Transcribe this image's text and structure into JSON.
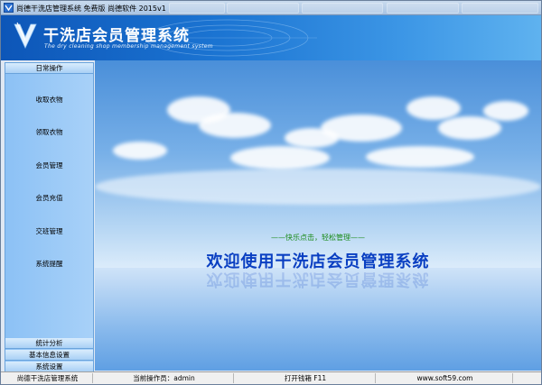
{
  "window": {
    "title": "尚德干洗店管理系统 免费版 尚德软件 2015v1"
  },
  "banner": {
    "title": "干洗店会员管理系统",
    "subtitle": "The dry cleaning shop membership management system"
  },
  "sidebar": {
    "top_header": "日常操作",
    "items": [
      {
        "label": "收取衣物",
        "icon": "none"
      },
      {
        "label": "领取衣物",
        "icon": "none"
      },
      {
        "label": "会员管理",
        "icon": "none"
      },
      {
        "label": "会员充值",
        "icon": "none"
      },
      {
        "label": "交班管理",
        "icon": "none"
      },
      {
        "label": "系统提醒",
        "icon": "none"
      }
    ],
    "bottom_headers": [
      "统计分析",
      "基本信息设置",
      "系统设置"
    ]
  },
  "main": {
    "tagline": "——快乐点击，轻松管理——",
    "welcome": "欢迎使用干洗店会员管理系统"
  },
  "statusbar": {
    "app_name": "尚德干洗店管理系统",
    "operator": "当前操作员：admin",
    "cashbox": "打开钱箱 F11",
    "website": "www.soft59.com"
  },
  "colors": {
    "banner_accent": "#1b74d2",
    "welcome_text": "#0a3fc2",
    "tagline_text": "#1c8c1c",
    "sidebar_bg": "#a8d1f8"
  }
}
